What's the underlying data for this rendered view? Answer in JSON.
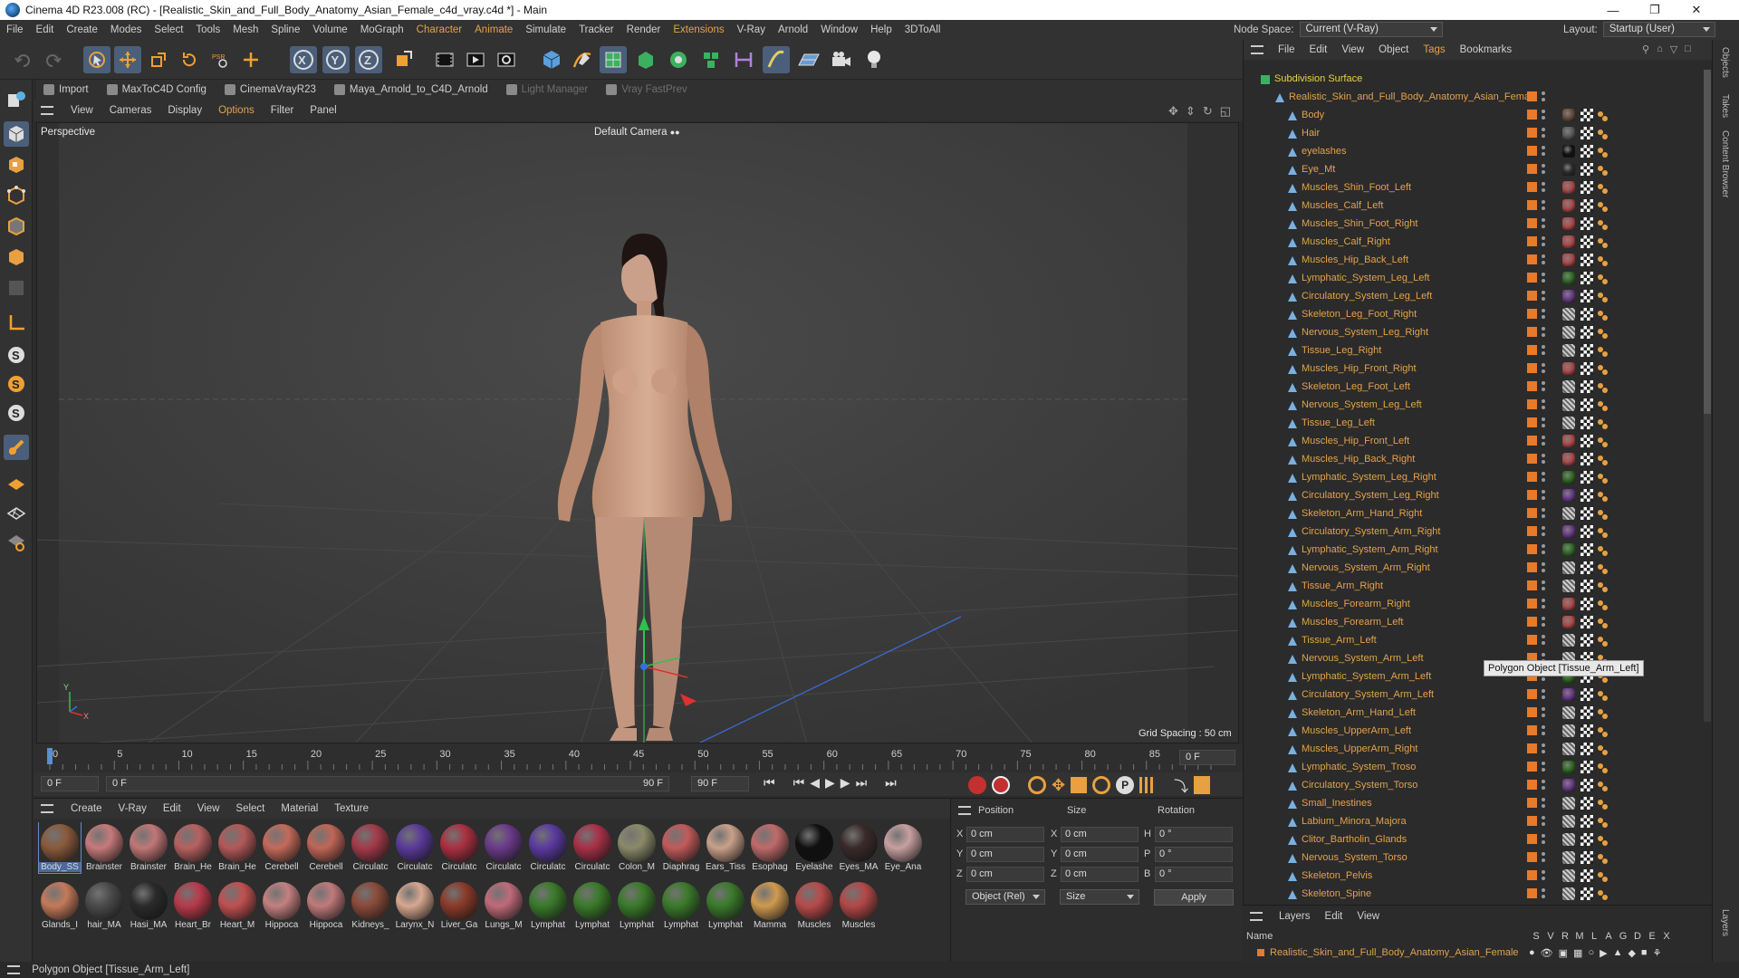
{
  "window": {
    "title": "Cinema 4D R23.008 (RC) - [Realistic_Skin_and_Full_Body_Anatomy_Asian_Female_c4d_vray.c4d *] - Main"
  },
  "menu": [
    "File",
    "Edit",
    "Create",
    "Modes",
    "Select",
    "Tools",
    "Mesh",
    "Spline",
    "Volume",
    "MoGraph",
    "Character",
    "Animate",
    "Simulate",
    "Tracker",
    "Render",
    "Extensions",
    "V-Ray",
    "Arnold",
    "Window",
    "Help",
    "3DToAll"
  ],
  "menu_highlight": [
    "Character",
    "Animate",
    "Extensions"
  ],
  "node_space": {
    "label": "Node Space:",
    "value": "Current (V-Ray)"
  },
  "layout": {
    "label": "Layout:",
    "value": "Startup (User)"
  },
  "plugins": [
    {
      "label": "Import",
      "dim": false
    },
    {
      "label": "MaxToC4D Config",
      "dim": false
    },
    {
      "label": "CinemaVrayR23",
      "dim": false
    },
    {
      "label": "Maya_Arnold_to_C4D_Arnold",
      "dim": false
    },
    {
      "label": "Light Manager",
      "dim": true
    },
    {
      "label": "Vray FastPrev",
      "dim": true
    }
  ],
  "viewport": {
    "menu": [
      "View",
      "Cameras",
      "Display",
      "Options",
      "Filter",
      "Panel"
    ],
    "menu_highlight": "Options",
    "view_name": "Perspective",
    "camera": "Default Camera",
    "grid_spacing": "Grid Spacing : 50 cm"
  },
  "timeline": {
    "ticks": [
      "0",
      "5",
      "10",
      "15",
      "20",
      "25",
      "30",
      "35",
      "40",
      "45",
      "50",
      "55",
      "60",
      "65",
      "70",
      "75",
      "80",
      "85",
      "90"
    ],
    "current_frame": "0 F",
    "start_frame": "0 F",
    "range_start": "0 F",
    "range_end": "90 F",
    "end_frame": "90 F"
  },
  "material_panel": {
    "menu": [
      "Create",
      "V-Ray",
      "Edit",
      "View",
      "Select",
      "Material",
      "Texture"
    ],
    "materials": [
      {
        "label": "Body_SS",
        "color": "#8a5a3c"
      },
      {
        "label": "Brainster",
        "color": "#c77a7a"
      },
      {
        "label": "Brainster",
        "color": "#c27676"
      },
      {
        "label": "Brain_He",
        "color": "#b86060"
      },
      {
        "label": "Brain_He",
        "color": "#b35858"
      },
      {
        "label": "Cerebell",
        "color": "#c46a5a"
      },
      {
        "label": "Cerebell",
        "color": "#c06656"
      },
      {
        "label": "Circulatc",
        "color": "#a33a4a"
      },
      {
        "label": "Circulatc",
        "color": "#5a3a9a"
      },
      {
        "label": "Circulatc",
        "color": "#aa3040"
      },
      {
        "label": "Circulatc",
        "color": "#6a3a8a"
      },
      {
        "label": "Circulatc",
        "color": "#5a3aa0"
      },
      {
        "label": "Circulatc",
        "color": "#a83048"
      },
      {
        "label": "Colon_M",
        "color": "#8a8a6a"
      },
      {
        "label": "Diaphrag",
        "color": "#c25a5a"
      },
      {
        "label": "Ears_Tiss",
        "color": "#c9a08a"
      },
      {
        "label": "Esophag",
        "color": "#c06a6a"
      },
      {
        "label": "Eyelashe",
        "color": "#101010"
      },
      {
        "label": "Eyes_MA",
        "color": "#3a2a2a"
      },
      {
        "label": "Eye_Ana",
        "color": "#c8a0a0"
      },
      {
        "label": "Glands_I",
        "color": "#c47a5a"
      },
      {
        "label": "hair_MA",
        "color": "#4a4a4a"
      },
      {
        "label": "Hasi_MA",
        "color": "#2a2a2a"
      },
      {
        "label": "Heart_Br",
        "color": "#b83a4a"
      },
      {
        "label": "Heart_M",
        "color": "#c05050"
      },
      {
        "label": "Hippoca",
        "color": "#c48080"
      },
      {
        "label": "Hippoca",
        "color": "#c07a7a"
      },
      {
        "label": "Kidneys_",
        "color": "#8a4a3a"
      },
      {
        "label": "Larynx_N",
        "color": "#d8a890"
      },
      {
        "label": "Liver_Ga",
        "color": "#8a3a2a"
      },
      {
        "label": "Lungs_M",
        "color": "#c06a7a"
      },
      {
        "label": "Lymphat",
        "color": "#3a7a2a"
      },
      {
        "label": "Lymphat",
        "color": "#3a7a2a"
      },
      {
        "label": "Lymphat",
        "color": "#3a7a2a"
      },
      {
        "label": "Lymphat",
        "color": "#3a7a2a"
      },
      {
        "label": "Lymphat",
        "color": "#3a7a2a"
      },
      {
        "label": "Mamma",
        "color": "#d09a50"
      },
      {
        "label": "Muscles",
        "color": "#b84a4a"
      },
      {
        "label": "Muscles",
        "color": "#b44848"
      }
    ]
  },
  "coords": {
    "headers": [
      "Position",
      "Size",
      "Rotation"
    ],
    "rows": [
      {
        "axis": "X",
        "pos": "0 cm",
        "saxis": "X",
        "size": "0 cm",
        "raxis": "H",
        "rot": "0 °"
      },
      {
        "axis": "Y",
        "pos": "0 cm",
        "saxis": "Y",
        "size": "0 cm",
        "raxis": "P",
        "rot": "0 °"
      },
      {
        "axis": "Z",
        "pos": "0 cm",
        "saxis": "Z",
        "size": "0 cm",
        "raxis": "B",
        "rot": "0 °"
      }
    ],
    "mode": "Object (Rel)",
    "size_mode": "Size",
    "apply": "Apply"
  },
  "object_manager": {
    "menu": [
      "File",
      "Edit",
      "View",
      "Object",
      "Tags",
      "Bookmarks"
    ],
    "menu_highlight": "Tags",
    "root": "Subdivision Surface",
    "group": "Realistic_Skin_and_Full_Body_Anatomy_Asian_Female",
    "objects": [
      {
        "name": "Body",
        "tag": "#6a4a3a"
      },
      {
        "name": "Hair",
        "tag": "#5a5a5a"
      },
      {
        "name": "eyelashes",
        "tag": "#111111"
      },
      {
        "name": "Eye_Mt",
        "tag": "#2a2a2a"
      },
      {
        "name": "Muscles_Shin_Foot_Left",
        "tag": "#b04848"
      },
      {
        "name": "Muscles_Calf_Left",
        "tag": "#b04848"
      },
      {
        "name": "Muscles_Shin_Foot_Right",
        "tag": "#b04848"
      },
      {
        "name": "Muscles_Calf_Right",
        "tag": "#b04848"
      },
      {
        "name": "Muscles_Hip_Back_Left",
        "tag": "#b04848"
      },
      {
        "name": "Lymphatic_System_Leg_Left",
        "tag": "#2f6a22"
      },
      {
        "name": "Circulatory_System_Leg_Left",
        "tag": "#6a3a8a"
      },
      {
        "name": "Skeleton_Leg_Foot_Right",
        "tag": "hatch"
      },
      {
        "name": "Nervous_System_Leg_Right",
        "tag": "hatch"
      },
      {
        "name": "Tissue_Leg_Right",
        "tag": "hatch"
      },
      {
        "name": "Muscles_Hip_Front_Right",
        "tag": "#b04848"
      },
      {
        "name": "Skeleton_Leg_Foot_Left",
        "tag": "hatch"
      },
      {
        "name": "Nervous_System_Leg_Left",
        "tag": "hatch"
      },
      {
        "name": "Tissue_Leg_Left",
        "tag": "hatch"
      },
      {
        "name": "Muscles_Hip_Front_Left",
        "tag": "#b04848"
      },
      {
        "name": "Muscles_Hip_Back_Right",
        "tag": "#b04848"
      },
      {
        "name": "Lymphatic_System_Leg_Right",
        "tag": "#2f6a22"
      },
      {
        "name": "Circulatory_System_Leg_Right",
        "tag": "#6a3a8a"
      },
      {
        "name": "Skeleton_Arm_Hand_Right",
        "tag": "hatch"
      },
      {
        "name": "Circulatory_System_Arm_Right",
        "tag": "#6a3a8a"
      },
      {
        "name": "Lymphatic_System_Arm_Right",
        "tag": "#2f6a22"
      },
      {
        "name": "Nervous_System_Arm_Right",
        "tag": "hatch"
      },
      {
        "name": "Tissue_Arm_Right",
        "tag": "hatch"
      },
      {
        "name": "Muscles_Forearm_Right",
        "tag": "#b04848"
      },
      {
        "name": "Muscles_Forearm_Left",
        "tag": "#b04848"
      },
      {
        "name": "Tissue_Arm_Left",
        "tag": "hatch"
      },
      {
        "name": "Nervous_System_Arm_Left",
        "tag": "hatch"
      },
      {
        "name": "Lymphatic_System_Arm_Left",
        "tag": "#2f6a22"
      },
      {
        "name": "Circulatory_System_Arm_Left",
        "tag": "#6a3a8a"
      },
      {
        "name": "Skeleton_Arm_Hand_Left",
        "tag": "hatch"
      },
      {
        "name": "Muscles_UpperArm_Left",
        "tag": "hatch"
      },
      {
        "name": "Muscles_UpperArm_Right",
        "tag": "hatch"
      },
      {
        "name": "Lymphatic_System_Troso",
        "tag": "#2f6a22"
      },
      {
        "name": "Circulatory_System_Torso",
        "tag": "#6a3a8a"
      },
      {
        "name": "Small_Inestines",
        "tag": "hatch"
      },
      {
        "name": "Labium_Minora_Majora",
        "tag": "hatch"
      },
      {
        "name": "Clitor_Bartholin_Glands",
        "tag": "hatch"
      },
      {
        "name": "Nervous_System_Torso",
        "tag": "hatch"
      },
      {
        "name": "Skeleton_Pelvis",
        "tag": "hatch"
      },
      {
        "name": "Skeleton_Spine",
        "tag": "hatch"
      }
    ],
    "tooltip": "Polygon Object [Tissue_Arm_Left]"
  },
  "layers": {
    "menu": [
      "Layers",
      "Edit",
      "View"
    ],
    "col_name": "Name",
    "cols": [
      "S",
      "V",
      "R",
      "M",
      "L",
      "A",
      "G",
      "D",
      "E",
      "X"
    ],
    "item": "Realistic_Skin_and_Full_Body_Anatomy_Asian_Female"
  },
  "side_tabs": [
    "Objects",
    "Takes",
    "Content Browser",
    "Layers"
  ],
  "status": "Polygon Object [Tissue_Arm_Left]",
  "colors": {
    "accent": "#e3a24a",
    "active_tool": "#4b5f7a",
    "layer_orange": "#e87a2a",
    "x_axis": "#e03030",
    "y_axis": "#30c050",
    "z_axis": "#3070e0"
  }
}
